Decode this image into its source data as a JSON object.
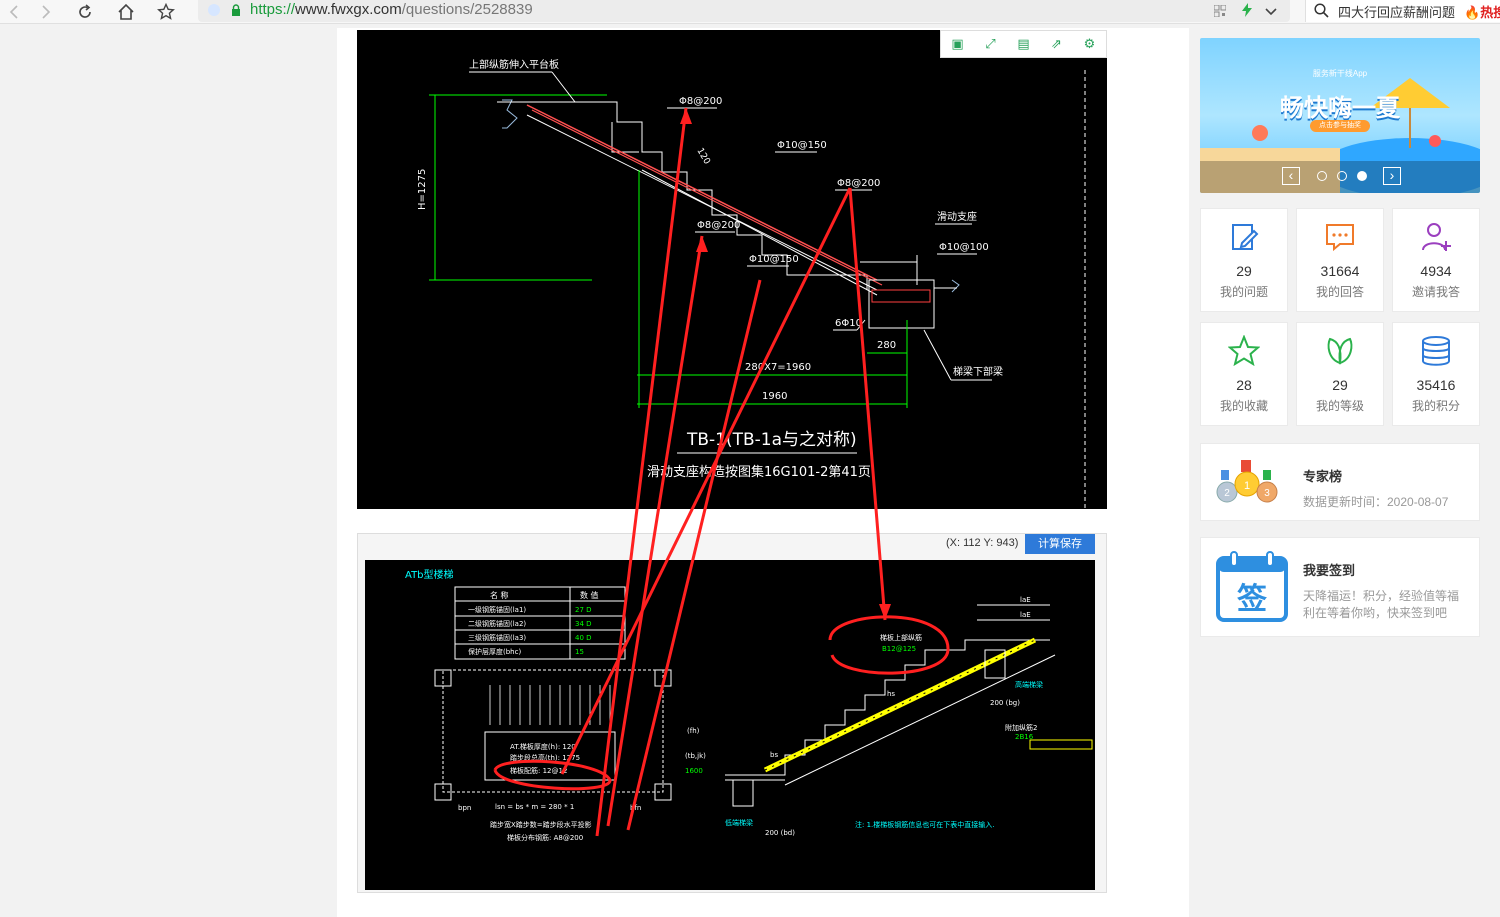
{
  "browser": {
    "url_scheme": "https://",
    "url_host": "www.fwxgx.com",
    "url_path": "/questions/2528839",
    "search_text": "四大行回应薪酬问题",
    "search_hot": "热搜"
  },
  "cad_top": {
    "notes": {
      "top_left": "上部纵筋伸入平台板",
      "height": "H=1275",
      "r1": "Φ8@200",
      "r2": "Φ10@150",
      "r3": "Φ8@200",
      "r4": "Φ8@200",
      "r5": "Φ10@150",
      "r6": "Φ10@100",
      "r7": "6Φ10",
      "slide": "滑动支座",
      "beam": "梯梁下部梁",
      "dim1": "280X7=1960",
      "dim2": "1960",
      "dim3": "280",
      "dim_slant": "120",
      "title": "TB-1(TB-1a与之对称)",
      "subtitle": "滑动支座构造按图集16G101-2第41页"
    }
  },
  "calc": {
    "coord": "(X: 112 Y: 943)",
    "save_button": "计算保存",
    "section_title": "ATb型楼梯",
    "table": {
      "headers": [
        "名 称",
        "数 值"
      ],
      "rows": [
        [
          "一级钢筋锚固(la1)",
          "27 D"
        ],
        [
          "二级钢筋锚固(la2)",
          "34 D"
        ],
        [
          "三级钢筋锚固(la3)",
          "40 D"
        ],
        [
          "保护层厚度(bhc)",
          "15"
        ]
      ]
    },
    "plan": {
      "thickness": "AT.梯板厚度(h): 120",
      "height": "踏步段总高(th): 1275",
      "bars": "梯板配筋: 12@12",
      "len": "lsn = bs * m = 280 * 1",
      "formula": "踏步宽X踏步数=踏步段水平投影",
      "dist": "梯板分布钢筋: A8@200",
      "fh": "(fh)",
      "tb": "(tb,jk)",
      "v1600": "1600",
      "bpn": "bpn",
      "bfn": "bfn"
    },
    "section": {
      "top_bar": "梯板上部纵筋",
      "top_bar_val": "B12@125",
      "high_beam": "高端梯梁",
      "low_beam": "低端梯梁",
      "add_bar": "附加纵筋2",
      "add_bar_val": "2B16",
      "hs": "hs",
      "bs": "bs",
      "bg": "200 (bg)",
      "bd": "200 (bd)",
      "laE": "laE",
      "note": "注: 1.楼梯板钢筋信息也可在下表中直接输入."
    }
  },
  "sidebar": {
    "banner": {
      "small": "服务新干线App",
      "title": "畅快嗨一夏",
      "cta": "点击参与抽奖",
      "prev": "‹",
      "next": "›"
    },
    "stats": [
      {
        "value": "29",
        "label": "我的问题",
        "icon": "edit-icon"
      },
      {
        "value": "31664",
        "label": "我的回答",
        "icon": "chat-icon"
      },
      {
        "value": "4934",
        "label": "邀请我答",
        "icon": "add-user-icon"
      },
      {
        "value": "28",
        "label": "我的收藏",
        "icon": "star-icon"
      },
      {
        "value": "29",
        "label": "我的等级",
        "icon": "leaf-icon"
      },
      {
        "value": "35416",
        "label": "我的积分",
        "icon": "coins-icon"
      }
    ],
    "experts": {
      "title": "专家榜",
      "desc": "数据更新时间：2020-08-07",
      "medal1": "1",
      "medal2": "2",
      "medal3": "3"
    },
    "signin": {
      "title": "我要签到",
      "desc1": "天降福运！积分，经验值等福",
      "desc2": "利在等着你哟，快来签到吧",
      "badge": "签"
    }
  },
  "colors": {
    "accent": "#2e7ad9",
    "cad_bg": "#000000",
    "cad_line": "#ffffff",
    "cad_dim": "#00ff00",
    "cad_red": "#ff2020",
    "cad_yellow": "#ffff00",
    "cad_cyan": "#00ffff"
  }
}
